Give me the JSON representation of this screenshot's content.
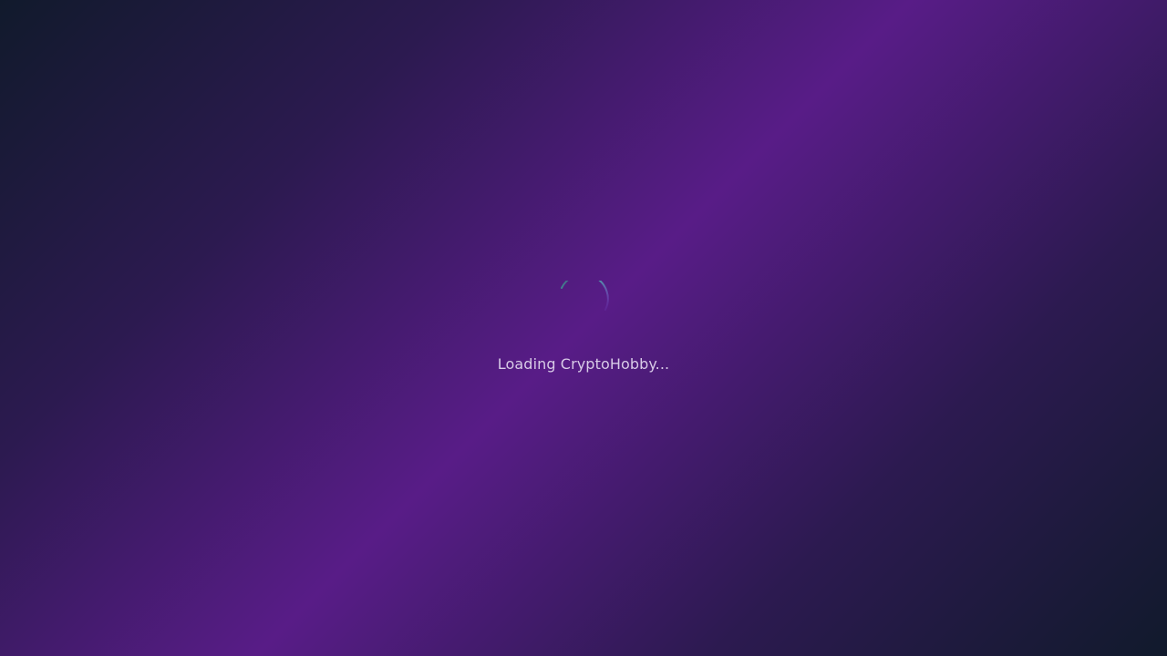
{
  "loading": {
    "message": "Loading CryptoHobby...",
    "spinner_icon": "spinner-icon",
    "spinner_color": "#34d399"
  },
  "theme": {
    "background_dark": "#111a2c",
    "background_accent": "#581c87",
    "text_color": "#d8cbe7"
  }
}
